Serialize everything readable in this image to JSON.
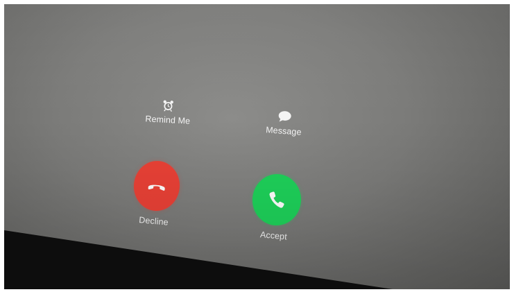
{
  "incoming_call": {
    "remind_label": "Remind Me",
    "message_label": "Message",
    "decline_label": "Decline",
    "accept_label": "Accept"
  },
  "icons": {
    "remind": "alarm-clock-icon",
    "message": "speech-bubble-icon",
    "decline": "phone-hangup-icon",
    "accept": "phone-icon"
  },
  "colors": {
    "decline": "#ea4136",
    "accept": "#1ed25a"
  }
}
